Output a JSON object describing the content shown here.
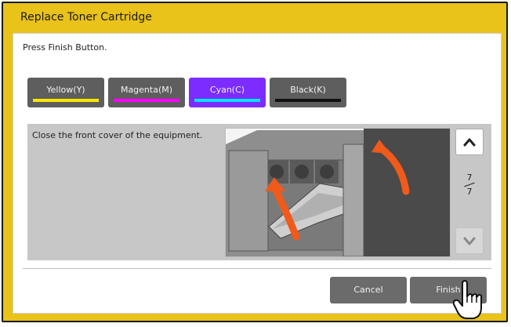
{
  "dialog": {
    "title": "Replace Toner Cartridge",
    "instruction": "Press Finish Button."
  },
  "toners": [
    {
      "label": "Yellow(Y)",
      "color": "#ffe500",
      "selected": false
    },
    {
      "label": "Magenta(M)",
      "color": "#ff00ff",
      "selected": false
    },
    {
      "label": "Cyan(C)",
      "color": "#00e5ff",
      "selected": true
    },
    {
      "label": "Black(K)",
      "color": "#111111",
      "selected": false
    }
  ],
  "step": {
    "message": "Close the front cover of the equipment.",
    "page_current": "7",
    "page_total": "7"
  },
  "buttons": {
    "cancel": "Cancel",
    "finish": "Finish"
  },
  "colors": {
    "frame": "#e9c21a",
    "selected_tab": "#7c2cff",
    "button": "#6b6b6b",
    "arrow": "#f05a1a"
  }
}
